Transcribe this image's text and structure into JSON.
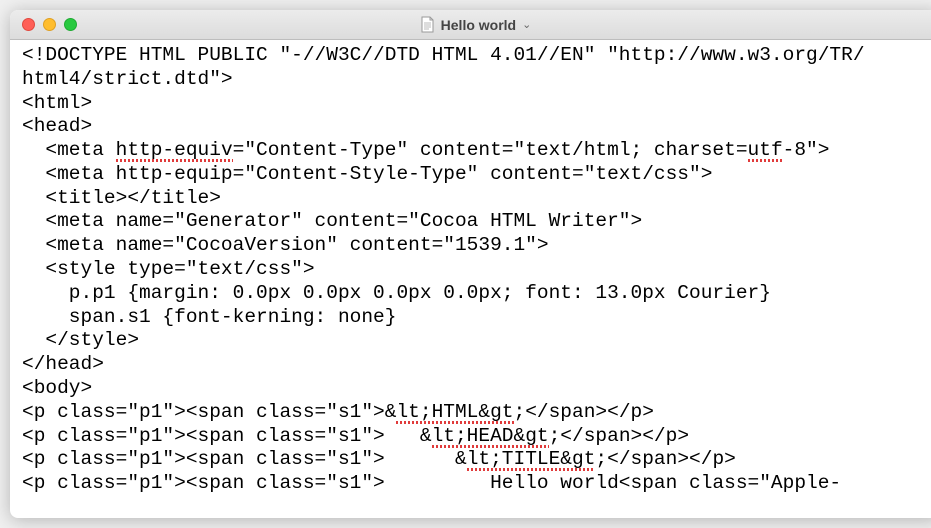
{
  "titlebar": {
    "document_title": "Hello world",
    "dropdown_glyph": "⌄"
  },
  "code": {
    "lines": [
      [
        {
          "t": "<!DOCTYPE HTML PUBLIC \"-//W3C//DTD HTML 4.01//EN\" \"http://www.w3.org/TR/"
        }
      ],
      [
        {
          "t": "html4/strict.dtd\">"
        }
      ],
      [
        {
          "t": "<html>"
        }
      ],
      [
        {
          "t": "<head>"
        }
      ],
      [
        {
          "t": "  <meta "
        },
        {
          "t": "http-equiv",
          "spell": true
        },
        {
          "t": "=\"Content-Type\" content=\"text/html; charset="
        },
        {
          "t": "utf",
          "spell": true
        },
        {
          "t": "-8\">"
        }
      ],
      [
        {
          "t": "  <meta http-equip=\"Content-Style-Type\" content=\"text/css\">"
        }
      ],
      [
        {
          "t": "  <title></title>"
        }
      ],
      [
        {
          "t": "  <meta name=\"Generator\" content=\"Cocoa HTML Writer\">"
        }
      ],
      [
        {
          "t": "  <meta name=\"CocoaVersion\" content=\"1539.1\">"
        }
      ],
      [
        {
          "t": "  <style type=\"text/css\">"
        }
      ],
      [
        {
          "t": "    p.p1 {margin: 0.0px 0.0px 0.0px 0.0px; font: 13.0px Courier}"
        }
      ],
      [
        {
          "t": "    span.s1 {font-kerning: none}"
        }
      ],
      [
        {
          "t": "  </style>"
        }
      ],
      [
        {
          "t": "</head>"
        }
      ],
      [
        {
          "t": "<body>"
        }
      ],
      [
        {
          "t": "<p class=\"p1\"><span class=\"s1\">&"
        },
        {
          "t": "lt;HTML&gt",
          "spell": true
        },
        {
          "t": ";</span></p>"
        }
      ],
      [
        {
          "t": "<p class=\"p1\"><span class=\"s1\">   &"
        },
        {
          "t": "lt;HEAD&gt",
          "spell": true
        },
        {
          "t": ";</span></p>"
        }
      ],
      [
        {
          "t": "<p class=\"p1\"><span class=\"s1\">      &"
        },
        {
          "t": "lt;TITLE&gt",
          "spell": true
        },
        {
          "t": ";</span></p>"
        }
      ],
      [
        {
          "t": "<p class=\"p1\"><span class=\"s1\">         Hello world<span class=\"Apple-"
        }
      ]
    ]
  }
}
